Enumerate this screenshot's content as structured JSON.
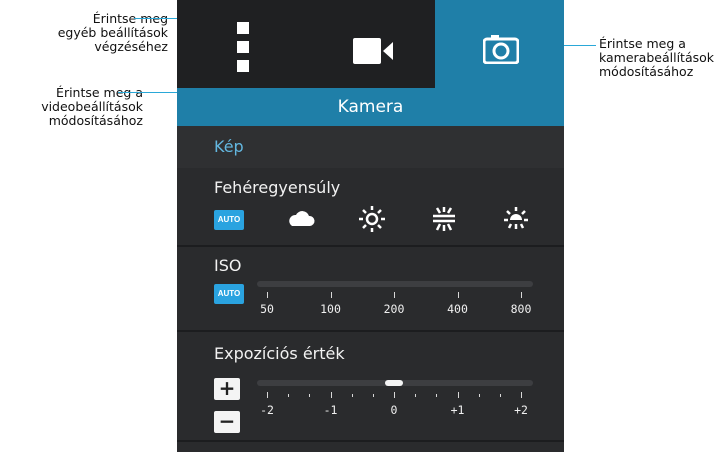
{
  "callouts": {
    "more_settings": "Érintse meg\negyéb beállítások\nvégzéséhez",
    "video_settings": "Érintse meg a\nvideobeállítások\nmódosításához",
    "camera_settings": "Érintse meg a\nkamerabeállítások\nmódosításához"
  },
  "tabs": [
    {
      "icon": "more-vertical-icon"
    },
    {
      "icon": "video-camera-icon"
    },
    {
      "icon": "camera-icon",
      "active": true
    }
  ],
  "header": {
    "title": "Kamera"
  },
  "section": {
    "title": "Kép"
  },
  "white_balance": {
    "label": "Fehéregyensúly",
    "auto_badge": "AUTO",
    "options": [
      "cloudy-icon",
      "sunny-icon",
      "fluorescent-icon",
      "incandescent-icon"
    ]
  },
  "iso": {
    "label": "ISO",
    "auto_badge": "AUTO",
    "ticks": [
      "50",
      "100",
      "200",
      "400",
      "800"
    ]
  },
  "exposure": {
    "label": "Expozíciós érték",
    "plus": "+",
    "minus": "−",
    "ticks": [
      "-2",
      "-1",
      "0",
      "+1",
      "+2"
    ],
    "value": 0
  },
  "colors": {
    "accent": "#1f7fa8",
    "leader": "#2aa8d8",
    "section_text": "#63b7e0",
    "badge": "#2aa3e0"
  }
}
